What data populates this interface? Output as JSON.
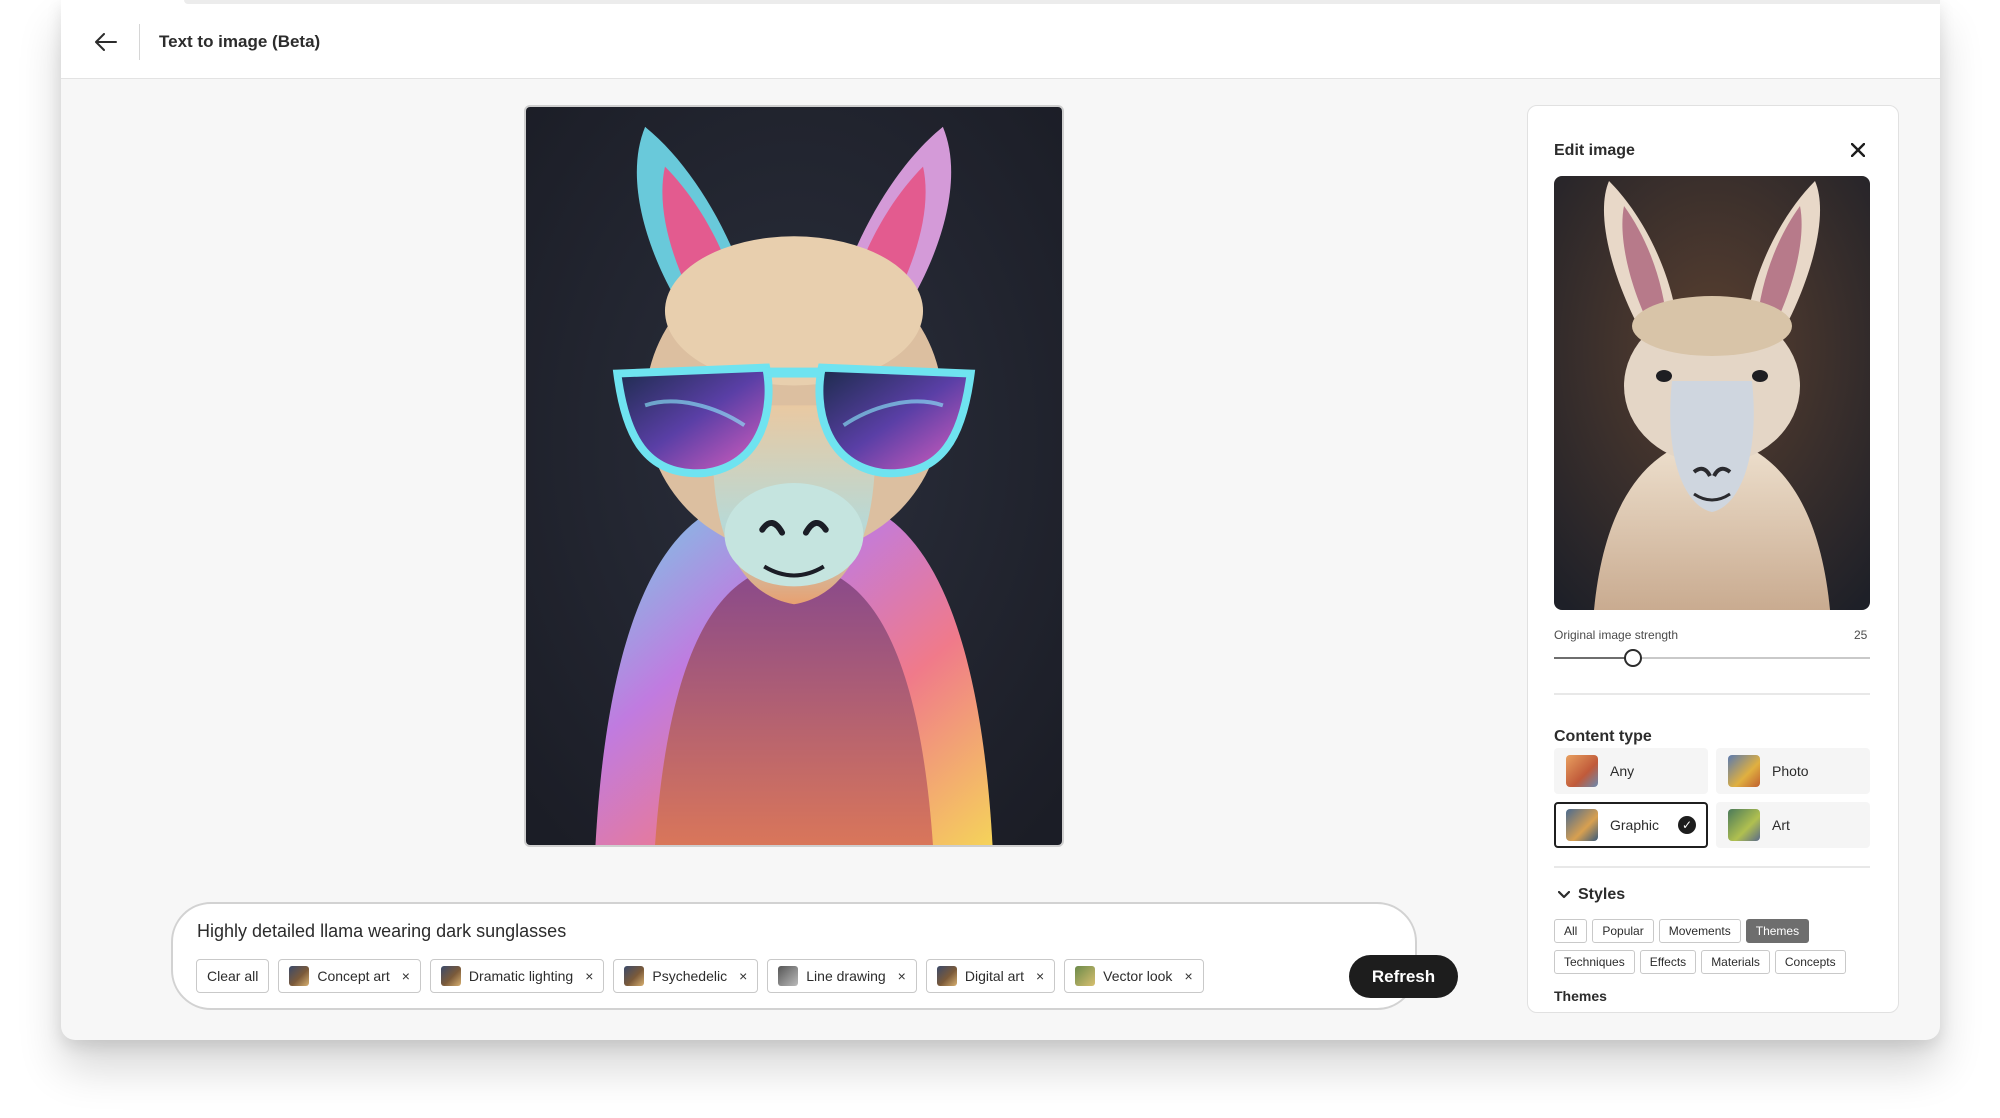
{
  "header": {
    "title": "Text to image (Beta)"
  },
  "icons": {
    "back": "arrow-left-icon",
    "close": "close-icon",
    "chevron": "chevron-down-icon",
    "check": "checkmark-icon"
  },
  "prompt": {
    "text": "Highly detailed llama wearing dark sunglasses",
    "clear_label": "Clear all",
    "chips": [
      "Concept art",
      "Dramatic lighting",
      "Psychedelic",
      "Line drawing",
      "Digital art",
      "Vector look"
    ],
    "remove_glyph": "×",
    "refresh_label": "Refresh"
  },
  "panel": {
    "title": "Edit image",
    "strength_label": "Original image strength",
    "strength_value": "25",
    "content_type_title": "Content type",
    "content_types": [
      "Any",
      "Photo",
      "Graphic",
      "Art"
    ],
    "content_type_selected": "Graphic",
    "styles_title": "Styles",
    "style_tabs_row1": [
      "All",
      "Popular",
      "Movements",
      "Themes"
    ],
    "style_tabs_row2": [
      "Techniques",
      "Effects",
      "Materials",
      "Concepts"
    ],
    "style_tab_active": "Themes",
    "themes_label": "Themes"
  }
}
